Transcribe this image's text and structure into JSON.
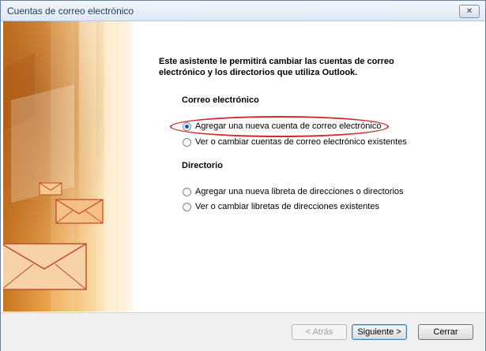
{
  "window": {
    "title": "Cuentas de correo electrónico",
    "close_glyph": "✕"
  },
  "intro": "Este asistente le permitirá cambiar las cuentas de correo electrónico y los directorios que utiliza Outlook.",
  "sections": {
    "email": {
      "title": "Correo electrónico",
      "options": [
        {
          "label": "Agregar una nueva cuenta de correo electrónico",
          "checked": true
        },
        {
          "label": "Ver o cambiar cuentas de correo electrónico existentes",
          "checked": false
        }
      ]
    },
    "directory": {
      "title": "Directorio",
      "options": [
        {
          "label": "Agregar una nueva libreta de direcciones o directorios",
          "checked": false
        },
        {
          "label": "Ver o cambiar libretas de direcciones existentes",
          "checked": false
        }
      ]
    }
  },
  "buttons": {
    "back": "< Atrás",
    "next": "Siguiente >",
    "cancel": "Cerrar"
  },
  "colors": {
    "highlight": "#d22a2a",
    "art_orange": "#e28a2b"
  }
}
